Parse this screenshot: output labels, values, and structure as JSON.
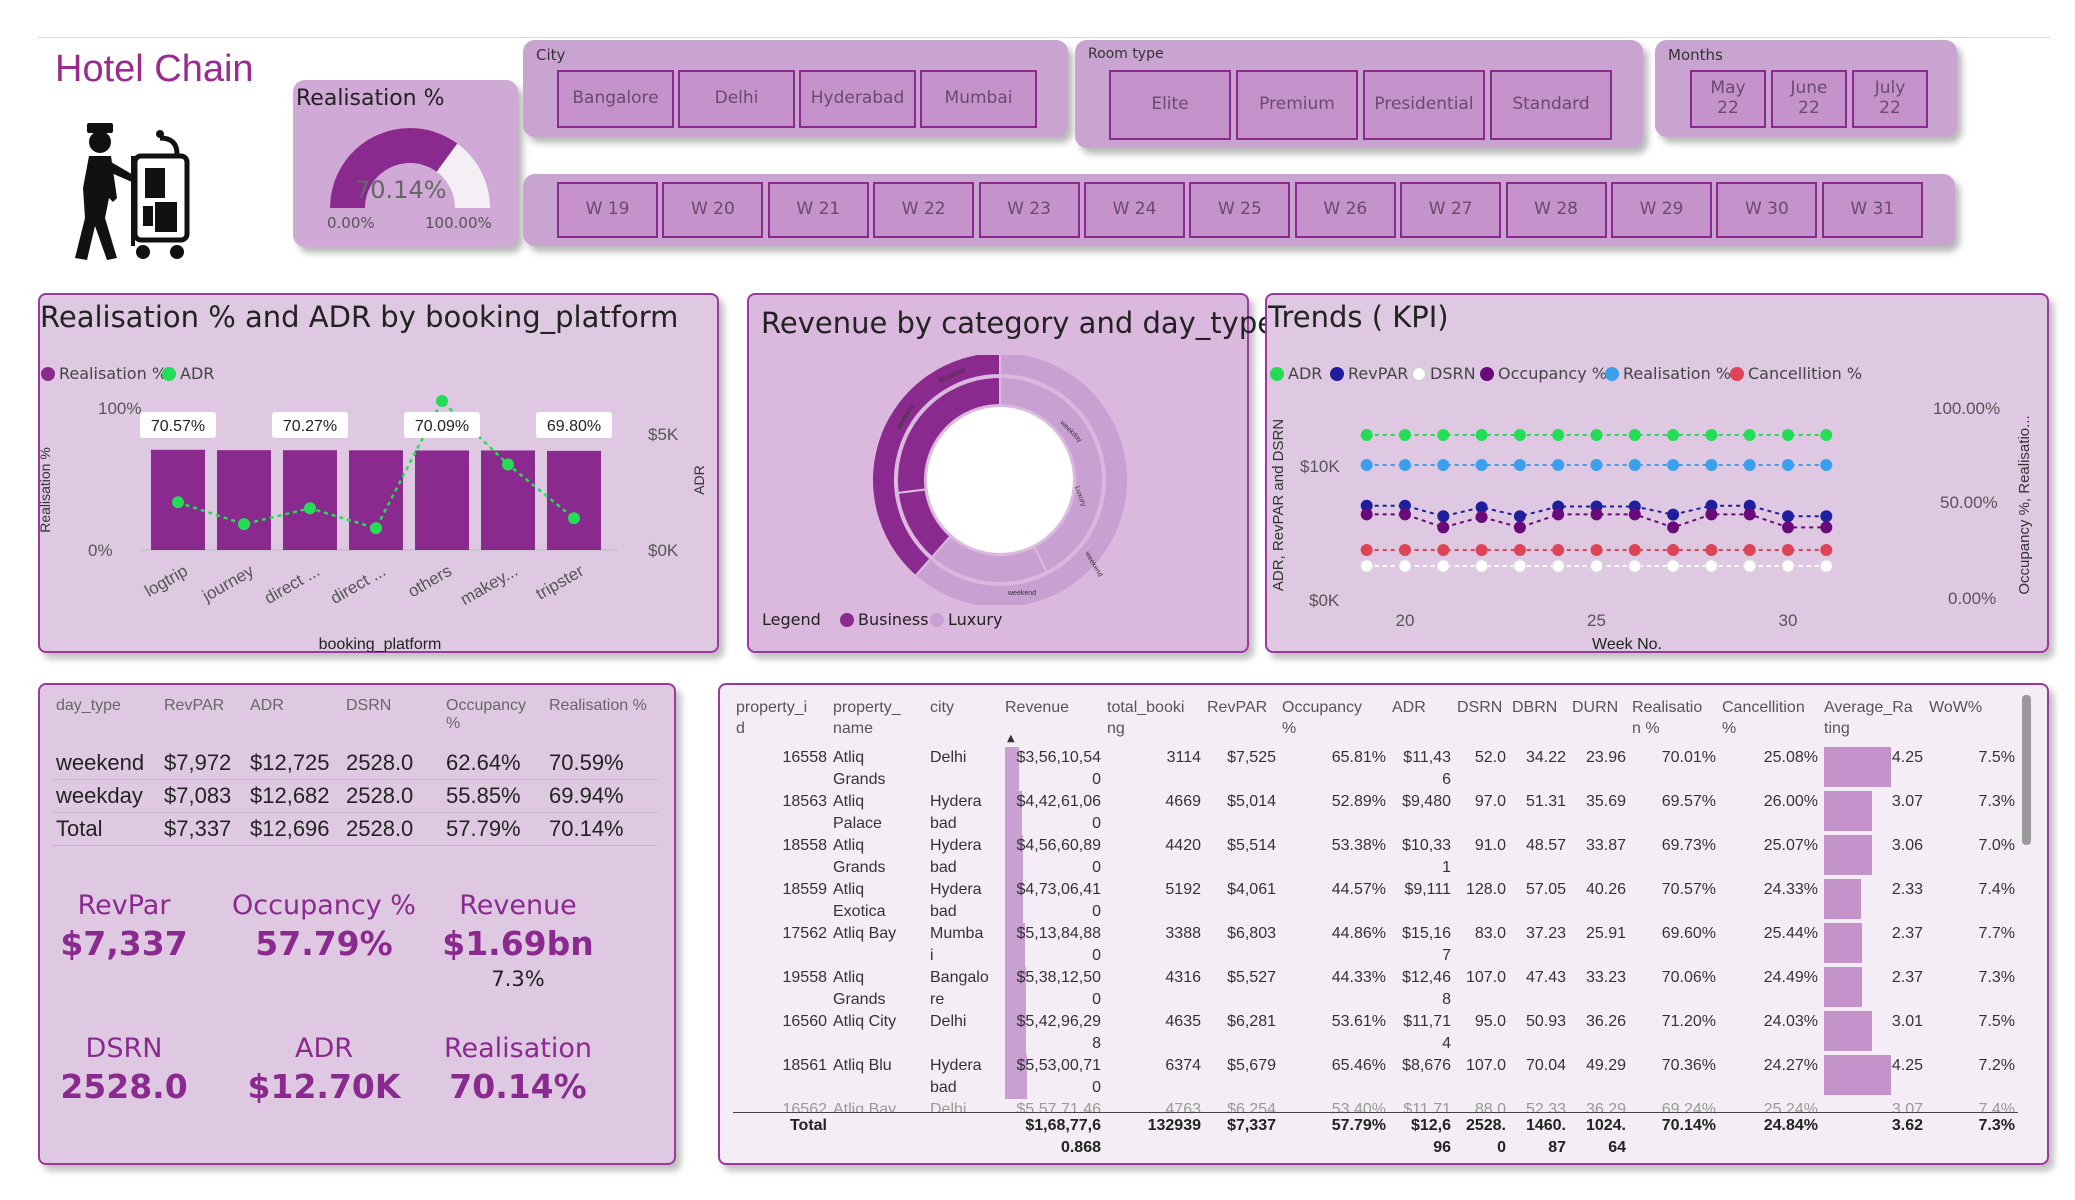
{
  "header": {
    "title": "Hotel Chain"
  },
  "gauge": {
    "title": "Realisation %",
    "value_label": "70.14%",
    "value": 0.7014,
    "min_label": "0.00%",
    "max_label": "100.00%"
  },
  "slicers": {
    "city": {
      "label": "City",
      "options": [
        "Bangalore",
        "Delhi",
        "Hyderabad",
        "Mumbai"
      ]
    },
    "room_type": {
      "label": "Room type",
      "options": [
        "Elite",
        "Premium",
        "Presidential",
        "Standard"
      ]
    },
    "months": {
      "label": "Months",
      "options": [
        [
          "May",
          "22"
        ],
        [
          "June",
          "22"
        ],
        [
          "July",
          "22"
        ]
      ]
    },
    "weeks": {
      "options": [
        "W 19",
        "W 20",
        "W 21",
        "W 22",
        "W 23",
        "W 24",
        "W 25",
        "W 26",
        "W 27",
        "W 28",
        "W 29",
        "W 30",
        "W 31"
      ]
    }
  },
  "colors": {
    "accent": "#8a2a8e",
    "card_bg": "#dfc9e2",
    "adr": "#22dd55",
    "revpar": "#1f1f9e",
    "occupancy": "#6a0a7a",
    "realisation": "#3aa0ee",
    "cancellation": "#dd4455",
    "dsrn": "#ffffff"
  },
  "chart_data": [
    {
      "type": "bar",
      "title": "Realisation % and ADR by booking_platform",
      "xlabel": "booking_platform",
      "ylabel": "Realisation %",
      "y2label": "ADR",
      "legend": [
        "Realisation %",
        "ADR"
      ],
      "categories": [
        "logtrip",
        "journey",
        "direct ...",
        "direct ...",
        "others",
        "makey...",
        "tripster"
      ],
      "y_ticks": [
        "100%",
        "0%"
      ],
      "y2_ticks": [
        "$5K",
        "$0K"
      ],
      "series": [
        {
          "name": "Realisation %",
          "type": "bar",
          "values": [
            70.57,
            70.3,
            70.27,
            70.2,
            70.09,
            70.1,
            69.8
          ]
        },
        {
          "name": "ADR",
          "type": "line",
          "values": [
            2400,
            1300,
            2100,
            1100,
            7500,
            4300,
            1600
          ]
        }
      ],
      "data_labels": [
        {
          "index": 0,
          "text": "70.57%"
        },
        {
          "index": 2,
          "text": "70.27%"
        },
        {
          "index": 4,
          "text": "70.09%"
        },
        {
          "index": 6,
          "text": "69.80%"
        }
      ],
      "ylim": [
        0,
        100
      ]
    },
    {
      "type": "pie",
      "title": "Revenue by category and day_type",
      "legend_title": "Legend",
      "legend": [
        "Business",
        "Luxury"
      ],
      "outer": [
        {
          "name": "Business",
          "value": 38.5
        },
        {
          "name": "Luxury",
          "value": 61.5
        }
      ],
      "inner": [
        {
          "name": "Business weekday",
          "value": 27
        },
        {
          "name": "Business weekend",
          "value": 11.5
        },
        {
          "name": "Luxury weekend",
          "value": 19
        },
        {
          "name": "Luxury weekday",
          "value": 42.5
        }
      ],
      "slice_labels": [
        "Business",
        "Luxury",
        "weekday",
        "weekend",
        "weekday",
        "weekend"
      ]
    },
    {
      "type": "line",
      "title": "Trends ( KPI)",
      "xlabel": "Week No.",
      "ylabel": "ADR, RevPAR and DSRN",
      "y2label": "Occupancy %, Realisatio...",
      "x_ticks": [
        "20",
        "25",
        "30"
      ],
      "y_ticks": [
        "$10K",
        "$0K"
      ],
      "y2_ticks": [
        "100.00%",
        "50.00%",
        "0.00%"
      ],
      "x": [
        19,
        20,
        21,
        22,
        23,
        24,
        25,
        26,
        27,
        28,
        29,
        30,
        31
      ],
      "series": [
        {
          "name": "ADR",
          "values": [
            12700,
            12700,
            12700,
            12700,
            12700,
            12700,
            12700,
            12700,
            12700,
            12700,
            12700,
            12700,
            12700
          ]
        },
        {
          "name": "RevPAR",
          "values": [
            7300,
            7300,
            6000,
            7100,
            6000,
            7200,
            7200,
            7200,
            6200,
            7300,
            7300,
            6000,
            6000
          ]
        },
        {
          "name": "DSRN",
          "values": [
            1800,
            1800,
            1800,
            1800,
            1800,
            1800,
            1800,
            1800,
            1800,
            1800,
            1800,
            1800,
            1800
          ]
        },
        {
          "name": "Occupancy %",
          "values": [
            62,
            62,
            52,
            60,
            52,
            62,
            62,
            62,
            52,
            62,
            62,
            52,
            52
          ]
        },
        {
          "name": "Realisation %",
          "values": [
            70,
            70,
            70,
            70,
            70,
            70,
            70,
            70,
            70,
            70,
            70,
            70,
            70
          ]
        },
        {
          "name": "Cancellition %",
          "values": [
            25,
            25,
            25,
            25,
            25,
            25,
            25,
            25,
            25,
            25,
            25,
            25,
            25
          ]
        }
      ]
    }
  ],
  "day_type_table": {
    "headers": [
      "day_type",
      "RevPAR",
      "ADR",
      "DSRN",
      "Occupancy %",
      "Realisation %"
    ],
    "rows": [
      [
        "weekend",
        "$7,972",
        "$12,725",
        "2528.0",
        "62.64%",
        "70.59%"
      ],
      [
        "weekday",
        "$7,083",
        "$12,682",
        "2528.0",
        "55.85%",
        "69.94%"
      ],
      [
        "Total",
        "$7,337",
        "$12,696",
        "2528.0",
        "57.79%",
        "70.14%"
      ]
    ]
  },
  "kpis": [
    {
      "label": "RevPar",
      "value": "$7,337"
    },
    {
      "label": "Occupancy %",
      "value": "57.79%"
    },
    {
      "label": "Revenue",
      "value": "$1.69bn",
      "sub": "7.3%"
    },
    {
      "label": "DSRN",
      "value": "2528.0"
    },
    {
      "label": "ADR",
      "value": "$12.70K"
    },
    {
      "label": "Realisation",
      "value": "70.14%"
    }
  ],
  "property_table": {
    "headers": [
      "property_id",
      "property_name",
      "city",
      "Revenue",
      "total_booking",
      "RevPAR",
      "Occupancy %",
      "ADR",
      "DSRN",
      "DBRN",
      "DURN",
      "Realisation %",
      "Cancellition %",
      "Average_Rating",
      "WoW%"
    ],
    "header_display": [
      [
        "property_i",
        "d"
      ],
      [
        "property_",
        "name"
      ],
      [
        "city",
        ""
      ],
      [
        "Revenue",
        ""
      ],
      [
        "total_booki",
        "ng"
      ],
      [
        "RevPAR",
        ""
      ],
      [
        "Occupancy",
        "%"
      ],
      [
        "ADR",
        ""
      ],
      [
        "DSRN",
        ""
      ],
      [
        "DBRN",
        ""
      ],
      [
        "DURN",
        ""
      ],
      [
        "Realisatio",
        "n %"
      ],
      [
        "Cancellition",
        "%"
      ],
      [
        "Average_Ra",
        "ting"
      ],
      [
        "WoW%",
        ""
      ]
    ],
    "rows": [
      {
        "id": "16558",
        "name": [
          "Atliq",
          "Grands"
        ],
        "city": [
          "Delhi",
          ""
        ],
        "revenue": [
          "$3,56,10,54",
          "0"
        ],
        "rev_frac": 0.14,
        "bookings": "3114",
        "revpar": "$7,525",
        "occ": "65.81%",
        "adr": [
          "$11,43",
          "6"
        ],
        "dsrn": "52.0",
        "dbrn": "34.22",
        "durn": "23.96",
        "real": "70.01%",
        "canc": "25.08%",
        "rating": "4.25",
        "rating_frac": 0.99,
        "wow": "7.5%"
      },
      {
        "id": "18563",
        "name": [
          "Atliq",
          "Palace"
        ],
        "city": [
          "Hydera",
          "bad"
        ],
        "revenue": [
          "$4,42,61,06",
          "0"
        ],
        "rev_frac": 0.17,
        "bookings": "4669",
        "revpar": "$5,014",
        "occ": "52.89%",
        "adr": [
          "$9,480",
          ""
        ],
        "dsrn": "97.0",
        "dbrn": "51.31",
        "durn": "35.69",
        "real": "69.57%",
        "canc": "26.00%",
        "rating": "3.07",
        "rating_frac": 0.72,
        "wow": "7.3%"
      },
      {
        "id": "18558",
        "name": [
          "Atliq",
          "Grands"
        ],
        "city": [
          "Hydera",
          "bad"
        ],
        "revenue": [
          "$4,56,60,89",
          "0"
        ],
        "rev_frac": 0.175,
        "bookings": "4420",
        "revpar": "$5,514",
        "occ": "53.38%",
        "adr": [
          "$10,33",
          "1"
        ],
        "dsrn": "91.0",
        "dbrn": "48.57",
        "durn": "33.87",
        "real": "69.73%",
        "canc": "25.07%",
        "rating": "3.06",
        "rating_frac": 0.72,
        "wow": "7.0%"
      },
      {
        "id": "18559",
        "name": [
          "Atliq",
          "Exotica"
        ],
        "city": [
          "Hydera",
          "bad"
        ],
        "revenue": [
          "$4,73,06,41",
          "0"
        ],
        "rev_frac": 0.18,
        "bookings": "5192",
        "revpar": "$4,061",
        "occ": "44.57%",
        "adr": [
          "$9,111",
          ""
        ],
        "dsrn": "128.0",
        "dbrn": "57.05",
        "durn": "40.26",
        "real": "70.57%",
        "canc": "24.33%",
        "rating": "2.33",
        "rating_frac": 0.55,
        "wow": "7.4%"
      },
      {
        "id": "17562",
        "name": [
          "Atliq Bay",
          ""
        ],
        "city": [
          "Mumba",
          "i"
        ],
        "revenue": [
          "$5,13,84,88",
          "0"
        ],
        "rev_frac": 0.2,
        "bookings": "3388",
        "revpar": "$6,803",
        "occ": "44.86%",
        "adr": [
          "$15,16",
          "7"
        ],
        "dsrn": "83.0",
        "dbrn": "37.23",
        "durn": "25.91",
        "real": "69.60%",
        "canc": "25.44%",
        "rating": "2.37",
        "rating_frac": 0.56,
        "wow": "7.7%"
      },
      {
        "id": "19558",
        "name": [
          "Atliq",
          "Grands"
        ],
        "city": [
          "Bangalo",
          "re"
        ],
        "revenue": [
          "$5,38,12,50",
          "0"
        ],
        "rev_frac": 0.21,
        "bookings": "4316",
        "revpar": "$5,527",
        "occ": "44.33%",
        "adr": [
          "$12,46",
          "8"
        ],
        "dsrn": "107.0",
        "dbrn": "47.43",
        "durn": "33.23",
        "real": "70.06%",
        "canc": "24.49%",
        "rating": "2.37",
        "rating_frac": 0.56,
        "wow": "7.3%"
      },
      {
        "id": "16560",
        "name": [
          "Atliq City",
          ""
        ],
        "city": [
          "Delhi",
          ""
        ],
        "revenue": [
          "$5,42,96,29",
          "8"
        ],
        "rev_frac": 0.21,
        "bookings": "4635",
        "revpar": "$6,281",
        "occ": "53.61%",
        "adr": [
          "$11,71",
          "4"
        ],
        "dsrn": "95.0",
        "dbrn": "50.93",
        "durn": "36.26",
        "real": "71.20%",
        "canc": "24.03%",
        "rating": "3.01",
        "rating_frac": 0.71,
        "wow": "7.5%"
      },
      {
        "id": "18561",
        "name": [
          "Atliq Blu",
          ""
        ],
        "city": [
          "Hydera",
          "bad"
        ],
        "revenue": [
          "$5,53,00,71",
          "0"
        ],
        "rev_frac": 0.215,
        "bookings": "6374",
        "revpar": "$5,679",
        "occ": "65.46%",
        "adr": [
          "$8,676",
          ""
        ],
        "dsrn": "107.0",
        "dbrn": "70.04",
        "durn": "49.29",
        "real": "70.36%",
        "canc": "24.27%",
        "rating": "4.25",
        "rating_frac": 0.99,
        "wow": "7.2%"
      }
    ],
    "partial_row": [
      "16562",
      "Atliq Bay",
      "Delhi",
      "$5,57,71,46",
      "4763",
      "$6,254",
      "53.40%",
      "$11,71",
      "88.0",
      "52.33",
      "36.29",
      "69.24%",
      "25.24%",
      "3.07",
      "7.4%"
    ],
    "total": {
      "label": "Total",
      "revenue": [
        "$1,68,77,6",
        "0.868"
      ],
      "bookings": "132939",
      "revpar": "$7,337",
      "occ": "57.79%",
      "adr": [
        "$12,6",
        "96"
      ],
      "dsrn": [
        "2528.",
        "0"
      ],
      "dbrn": [
        "1460.",
        "87"
      ],
      "durn": [
        "1024.",
        "64"
      ],
      "real": "70.14%",
      "canc": "24.84%",
      "rating": "3.62",
      "wow": "7.3%"
    }
  }
}
